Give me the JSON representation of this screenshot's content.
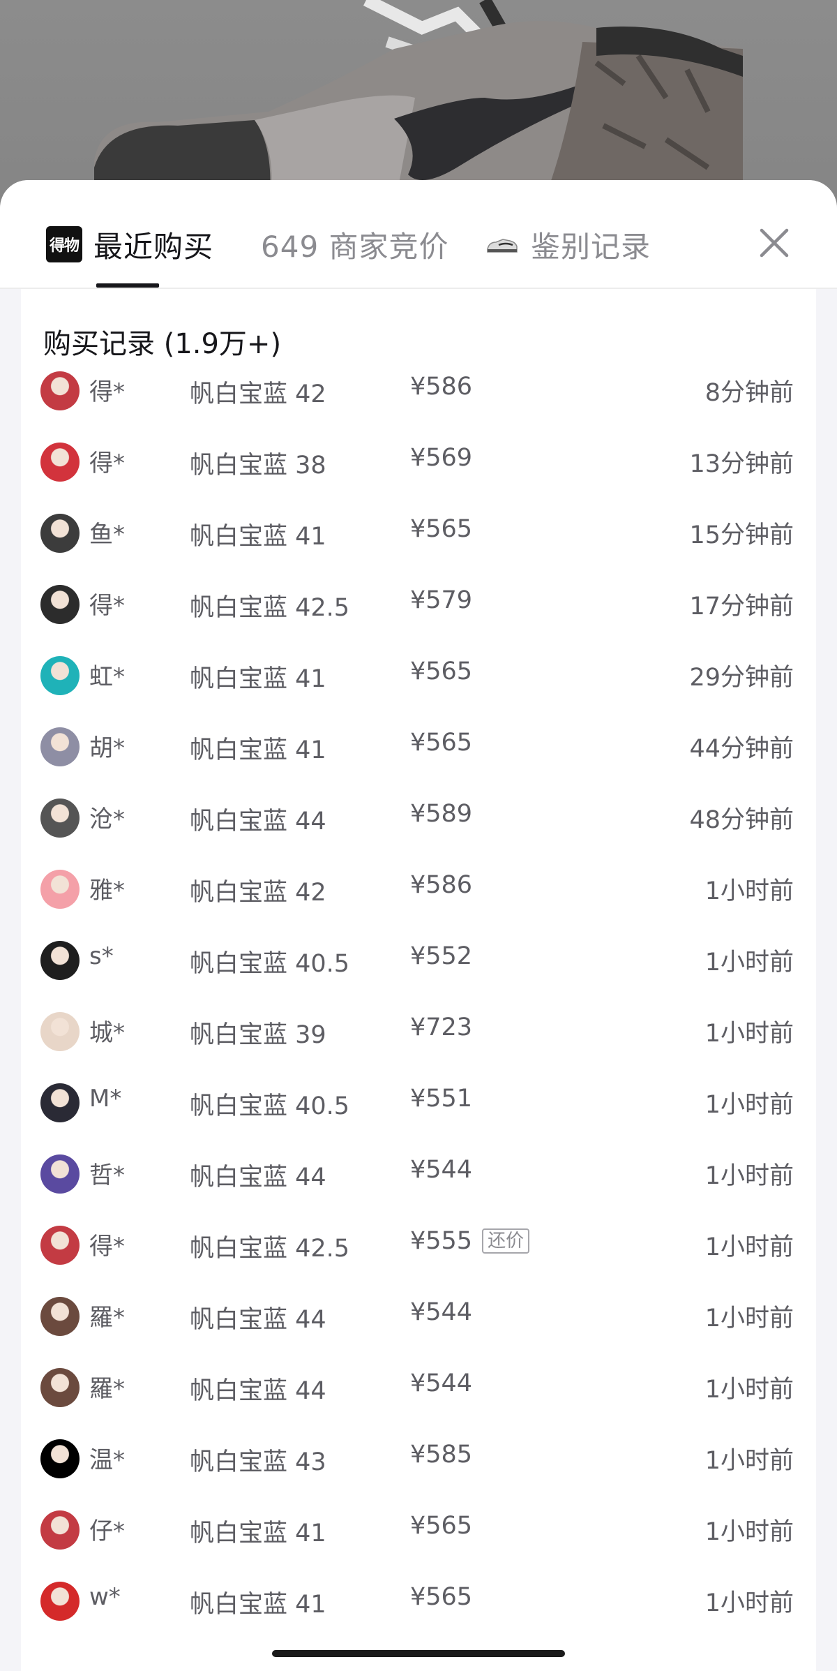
{
  "tabs": [
    {
      "label": "最近购买",
      "logo_text": "得物",
      "active": true
    },
    {
      "label": "649 商家竞价",
      "active": false
    },
    {
      "label": "鉴别记录",
      "active": false
    }
  ],
  "close_icon": "close-icon",
  "section_title": "购买记录 (1.9万+)",
  "haggle_label": "还价",
  "records": [
    {
      "user": "得*",
      "spec": "帆白宝蓝 42",
      "price": "¥586",
      "time": "8分钟前",
      "avatar_color": "#c33b43"
    },
    {
      "user": "得*",
      "spec": "帆白宝蓝 38",
      "price": "¥569",
      "time": "13分钟前",
      "avatar_color": "#d2333c"
    },
    {
      "user": "鱼*",
      "spec": "帆白宝蓝 41",
      "price": "¥565",
      "time": "15分钟前",
      "avatar_color": "#3c3c3c"
    },
    {
      "user": "得*",
      "spec": "帆白宝蓝 42.5",
      "price": "¥579",
      "time": "17分钟前",
      "avatar_color": "#2c2c2c"
    },
    {
      "user": "虹*",
      "spec": "帆白宝蓝 41",
      "price": "¥565",
      "time": "29分钟前",
      "avatar_color": "#1fb2b8"
    },
    {
      "user": "胡*",
      "spec": "帆白宝蓝 41",
      "price": "¥565",
      "time": "44分钟前",
      "avatar_color": "#8e8ea4"
    },
    {
      "user": "沧*",
      "spec": "帆白宝蓝 44",
      "price": "¥589",
      "time": "48分钟前",
      "avatar_color": "#555555"
    },
    {
      "user": "雅*",
      "spec": "帆白宝蓝 42",
      "price": "¥586",
      "time": "1小时前",
      "avatar_color": "#f4a0a8"
    },
    {
      "user": "s*",
      "spec": "帆白宝蓝 40.5",
      "price": "¥552",
      "time": "1小时前",
      "avatar_color": "#1e1e1e"
    },
    {
      "user": "城*",
      "spec": "帆白宝蓝 39",
      "price": "¥723",
      "time": "1小时前",
      "avatar_color": "#e8d6c8"
    },
    {
      "user": "M*",
      "spec": "帆白宝蓝 40.5",
      "price": "¥551",
      "time": "1小时前",
      "avatar_color": "#2a2a35"
    },
    {
      "user": "哲*",
      "spec": "帆白宝蓝 44",
      "price": "¥544",
      "time": "1小时前",
      "avatar_color": "#5a4aa0"
    },
    {
      "user": "得*",
      "spec": "帆白宝蓝 42.5",
      "price": "¥555",
      "time": "1小时前",
      "avatar_color": "#c33b43",
      "haggle": true
    },
    {
      "user": "羅*",
      "spec": "帆白宝蓝 44",
      "price": "¥544",
      "time": "1小时前",
      "avatar_color": "#6b4a3e"
    },
    {
      "user": "羅*",
      "spec": "帆白宝蓝 44",
      "price": "¥544",
      "time": "1小时前",
      "avatar_color": "#6b4a3e"
    },
    {
      "user": "温*",
      "spec": "帆白宝蓝 43",
      "price": "¥585",
      "time": "1小时前",
      "avatar_color": "#000000"
    },
    {
      "user": "仔*",
      "spec": "帆白宝蓝 41",
      "price": "¥565",
      "time": "1小时前",
      "avatar_color": "#c33b43"
    },
    {
      "user": "w*",
      "spec": "帆白宝蓝 41",
      "price": "¥565",
      "time": "1小时前",
      "avatar_color": "#d42a2a"
    }
  ]
}
